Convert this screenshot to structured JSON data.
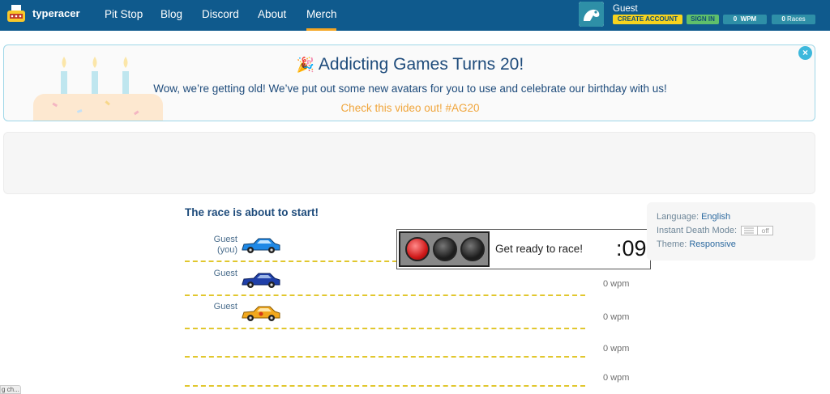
{
  "header": {
    "logo_text": "typeracer",
    "nav": [
      "Pit Stop",
      "Blog",
      "Discord",
      "About",
      "Merch"
    ],
    "user": {
      "name": "Guest",
      "create_account": "CREATE ACCOUNT",
      "sign_in": "SIGN IN",
      "wpm_value": "0",
      "wpm_unit": "WPM",
      "races_value": "0",
      "races_unit": "Races"
    },
    "colors": {
      "bar": "#0f5a8d",
      "active_underline": "#f5a623"
    }
  },
  "banner": {
    "title": "Addicting Games Turns 20!",
    "text": "Wow, we’re getting old! We’ve put out some new avatars for you to use and celebrate our birthday with us!",
    "link": "Check this video out! #AG20",
    "icons": [
      "party-popper-icon",
      "birthday-cake-icon",
      "close-icon"
    ]
  },
  "race": {
    "heading": "The race is about to start!",
    "racers": [
      {
        "name": "Guest",
        "you_label": "(you)",
        "wpm": "",
        "car_color": "#1e88e5"
      },
      {
        "name": "Guest",
        "you_label": "",
        "wpm": "0 wpm",
        "car_color": "#1f3fa8"
      },
      {
        "name": "Guest",
        "you_label": "",
        "wpm": "0 wpm",
        "car_color": "#f2a81d"
      },
      {
        "name": "",
        "you_label": "",
        "wpm": "0 wpm",
        "car_color": ""
      },
      {
        "name": "",
        "you_label": "",
        "wpm": "0 wpm",
        "car_color": ""
      }
    ],
    "countdown": {
      "message": "Get ready to race!",
      "time": ":09"
    }
  },
  "settings": {
    "language_label": "Language:",
    "language_value": "English",
    "instant_death_label": "Instant Death Mode:",
    "instant_death_value": "off",
    "theme_label": "Theme:",
    "theme_value": "Responsive"
  },
  "status_tip": "g ch..."
}
